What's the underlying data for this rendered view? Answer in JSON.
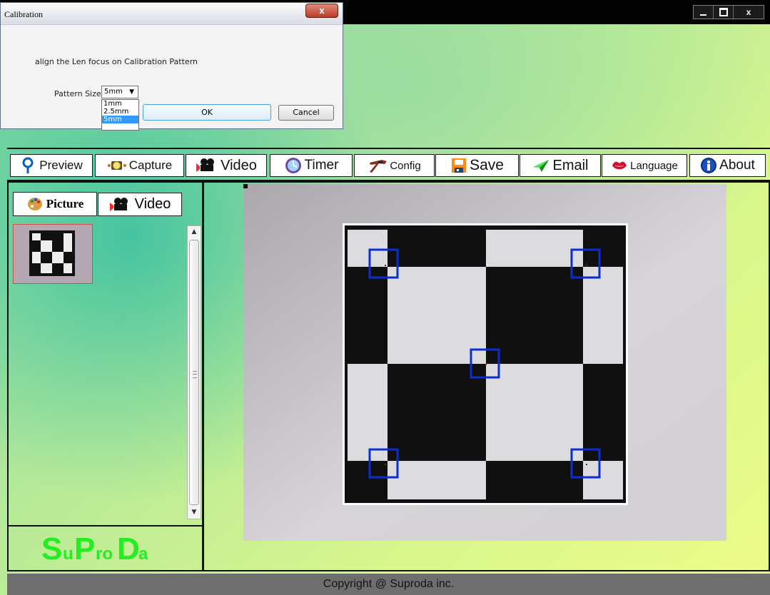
{
  "window": {
    "controls": {
      "close_label": "x"
    }
  },
  "dialog": {
    "title": "Calibration",
    "close_label": "x",
    "message": "align the Len focus on Calibration Pattern",
    "pattern_size_label": "Pattern Size",
    "selected_pattern_size": "5mm",
    "pattern_options": [
      "1mm",
      "2.5mm",
      "5mm"
    ],
    "ok_label": "OK",
    "cancel_label": "Cancel"
  },
  "toolbar": {
    "buttons": {
      "preview": {
        "label": "Preview",
        "icon": "magnifier-icon"
      },
      "capture": {
        "label": "Capture",
        "icon": "camera-icon"
      },
      "video": {
        "label": "Video",
        "icon": "movie-camera-icon"
      },
      "timer": {
        "label": "Timer",
        "icon": "timer-icon"
      },
      "config": {
        "label": "Config",
        "icon": "hammer-icon"
      },
      "save": {
        "label": "Save",
        "icon": "floppy-disk-icon"
      },
      "email": {
        "label": "Email",
        "icon": "send-arrow-icon"
      },
      "language": {
        "label": "Language",
        "icon": "lips-icon"
      },
      "about": {
        "label": "About",
        "icon": "info-icon"
      }
    }
  },
  "left_panel": {
    "tabs": {
      "picture": {
        "label": "Picture",
        "icon": "palette-icon"
      },
      "video": {
        "label": "Video",
        "icon": "movie-camera-icon"
      }
    },
    "thumbnail": {
      "description": "calibration-checkerboard-thumbnail"
    },
    "logo": {
      "text_s": "S",
      "text_u": "u",
      "text_p": "P",
      "text_ro": "ro",
      "text_d": "D",
      "text_a": "a"
    }
  },
  "preview": {
    "image": "calibration-checkerboard-preview"
  },
  "footer": {
    "copyright": "Copyright @ Suproda inc."
  },
  "colors": {
    "accent_blue": "#0033cc",
    "dialog_close": "#c94a35",
    "logo_green": "#22ee22",
    "footer_gray": "#6e6e6e"
  }
}
